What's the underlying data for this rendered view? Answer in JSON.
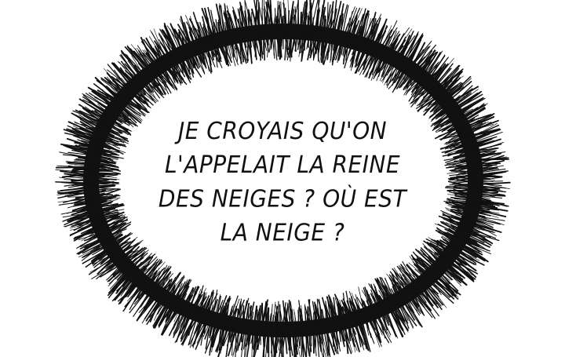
{
  "speech_bubble": {
    "lines": [
      "JE CROYAIS QU'ON",
      "L'APPELAIT LA REINE",
      "DES NEIGES ? OÙ EST",
      "LA NEIGE ?"
    ]
  },
  "colors": {
    "background": "#ffffff",
    "ink": "#111111"
  }
}
